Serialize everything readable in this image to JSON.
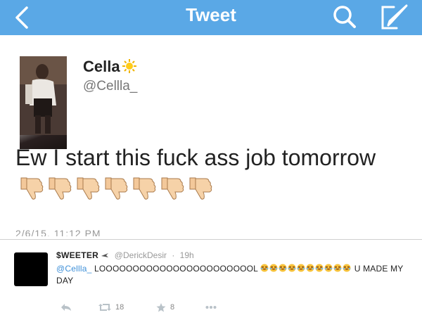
{
  "nav": {
    "title": "Tweet"
  },
  "tweet": {
    "name": "Cella",
    "handle": "@Cellla_",
    "text": "Ew I start this fuck ass job tomorrow",
    "timestamp": "2/6/15, 11:12 PM"
  },
  "reply": {
    "name": "$WEETER",
    "handle": "@DerickDesir",
    "dot": "·",
    "time": "19h",
    "mention": "@Cellla_",
    "text_main": "LOOOOOOOOOOOOOOOOOOOOOOOL",
    "text_tail": "U MADE MY DAY",
    "retweets": "18",
    "favorites": "8"
  },
  "colors": {
    "nav_bg": "#5aa8e6",
    "mention": "#3d8fd8"
  }
}
